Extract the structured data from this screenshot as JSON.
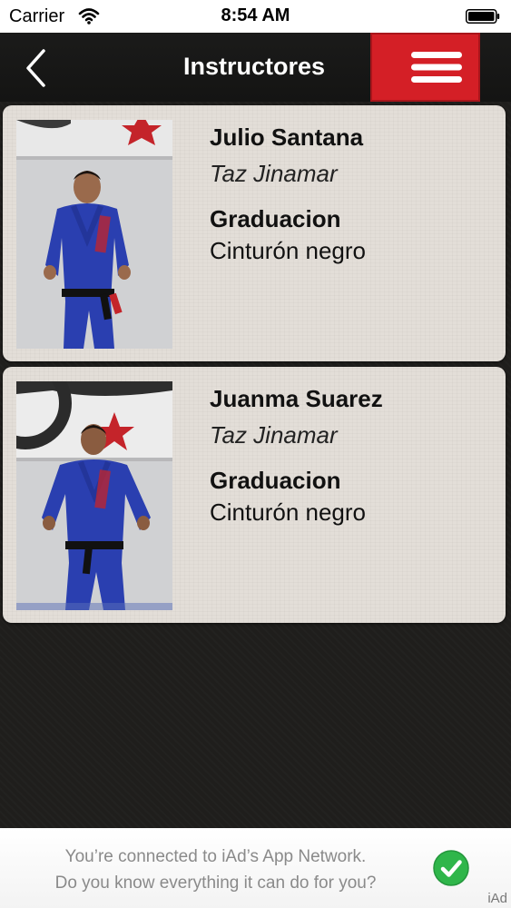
{
  "status_bar": {
    "carrier": "Carrier",
    "time": "8:54 AM",
    "wifi_icon": "wifi-icon",
    "battery_icon": "battery-icon"
  },
  "nav": {
    "title": "Instructores",
    "back_icon": "chevron-left-icon",
    "menu_icon": "hamburger-menu-icon",
    "menu_color": "#d41f26"
  },
  "instructors": [
    {
      "name": "Julio Santana",
      "location": "Taz Jinamar",
      "graduation_label": "Graduacion",
      "graduation": "Cinturón negro"
    },
    {
      "name": "Juanma Suarez",
      "location": "Taz Jinamar",
      "graduation_label": "Graduacion",
      "graduation": "Cinturón negro"
    }
  ],
  "iad": {
    "line1": "You’re connected to iAd’s App Network.",
    "line2": "Do you know everything it can do for you?",
    "logo": "iAd",
    "check_icon": "green-check-icon"
  }
}
